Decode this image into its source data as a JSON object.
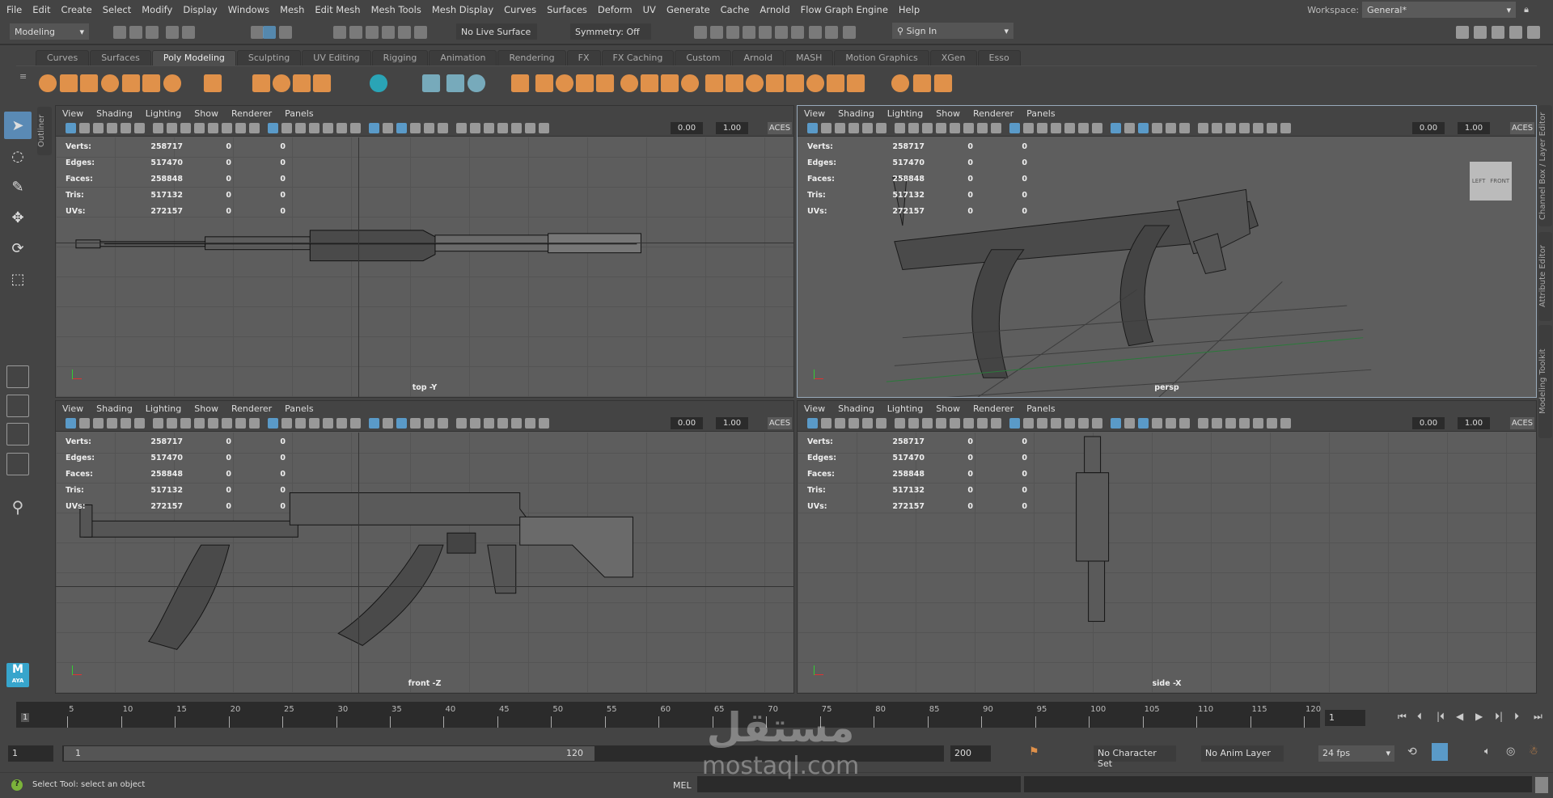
{
  "menubar": {
    "items": [
      "File",
      "Edit",
      "Create",
      "Select",
      "Modify",
      "Display",
      "Windows",
      "Mesh",
      "Edit Mesh",
      "Mesh Tools",
      "Mesh Display",
      "Curves",
      "Surfaces",
      "Deform",
      "UV",
      "Generate",
      "Cache",
      "Arnold",
      "Flow Graph Engine",
      "Help"
    ],
    "workspace_label": "Workspace:",
    "workspace_value": "General*"
  },
  "statusline": {
    "mode": "Modeling",
    "live_surface": "No Live Surface",
    "symmetry": "Symmetry: Off",
    "sign_in": "Sign In"
  },
  "shelf": {
    "tabs": [
      "Curves",
      "Surfaces",
      "Poly Modeling",
      "Sculpting",
      "UV Editing",
      "Rigging",
      "Animation",
      "Rendering",
      "FX",
      "FX Caching",
      "Custom",
      "Arnold",
      "MASH",
      "Motion Graphics",
      "XGen",
      "Esso"
    ],
    "active_tab": "Poly Modeling",
    "accent": "#e0914a",
    "icons": [
      "sphere",
      "cube",
      "cylinder",
      "cone",
      "torus",
      "diamond",
      "disc",
      "platonic",
      "super-shape",
      "helix",
      "text",
      "svg",
      "type-grid",
      "mirror",
      "snap-pivot",
      "measure-000",
      "combine",
      "separate",
      "smooth",
      "boolean",
      "extract",
      "bridge",
      "extrude",
      "fill-hole",
      "bevel",
      "append",
      "wedge",
      "offset-loop",
      "multi-cut",
      "target-weld",
      "connect",
      "quad-draw",
      "insert-loop",
      "curve-tool",
      "edit-edge-flow",
      "paint-tool"
    ]
  },
  "toolbox": {
    "tools": [
      "select-tool",
      "lasso-tool",
      "paint-select-tool",
      "move-tool",
      "rotate-tool",
      "scale-tool"
    ],
    "layouts": [
      "single-pane",
      "four-pane",
      "two-pane",
      "outliner-layout"
    ],
    "outliner_tab": "Outliner",
    "logo_text": "AYA"
  },
  "panel_menu": [
    "View",
    "Shading",
    "Lighting",
    "Show",
    "Renderer",
    "Panels"
  ],
  "panel_bar": {
    "exposure": "0.00",
    "gamma": "1.00",
    "colorspace": "ACES"
  },
  "hud": {
    "rows": [
      {
        "label": "Verts:",
        "value": "258717",
        "sel": "0",
        "uv": "0"
      },
      {
        "label": "Edges:",
        "value": "517470",
        "sel": "0",
        "uv": "0"
      },
      {
        "label": "Faces:",
        "value": "258848",
        "sel": "0",
        "uv": "0"
      },
      {
        "label": "Tris:",
        "value": "517132",
        "sel": "0",
        "uv": "0"
      },
      {
        "label": "UVs:",
        "value": "272157",
        "sel": "0",
        "uv": "0"
      }
    ]
  },
  "viewports": [
    {
      "label": "top -Y"
    },
    {
      "label": "persp"
    },
    {
      "label": "front -Z"
    },
    {
      "label": "side -X"
    }
  ],
  "viewcube": {
    "left": "LEFT",
    "front": "FRONT"
  },
  "righttabs": [
    "Channel Box / Layer Editor",
    "Attribute Editor",
    "Modeling Toolkit"
  ],
  "timeline": {
    "ticks": [
      "5",
      "10",
      "15",
      "20",
      "25",
      "30",
      "35",
      "40",
      "45",
      "50",
      "55",
      "60",
      "65",
      "70",
      "75",
      "80",
      "85",
      "90",
      "95",
      "100",
      "105",
      "110",
      "115",
      "120"
    ],
    "current_frame": "1",
    "frame_field": "1"
  },
  "range": {
    "start": "1",
    "inner_start": "1",
    "inner_end": "120",
    "end": "200",
    "character_set": "No Character Set",
    "anim_layer": "No Anim Layer",
    "fps": "24 fps"
  },
  "commandline": {
    "help": "Select Tool: select an object",
    "lang": "MEL"
  },
  "watermark": {
    "arabic": "مستقل",
    "latin": "mostaql.com"
  }
}
